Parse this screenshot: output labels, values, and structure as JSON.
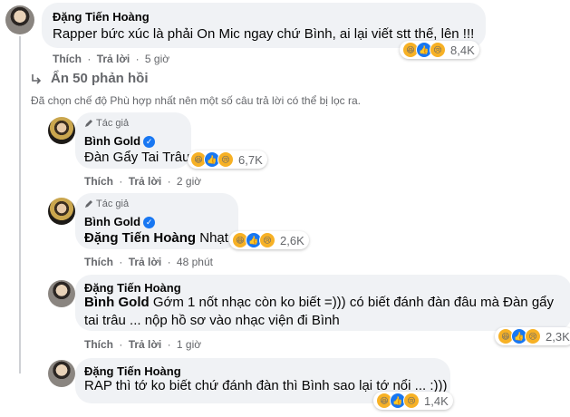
{
  "comments": [
    {
      "name": "Đặng Tiến Hoàng",
      "text": "Rapper bức xúc là phải On Mic ngay chứ Bình, ai lại viết stt thế, lên !!!",
      "like": "Thích",
      "reply": "Trả lời",
      "time": "5 giờ",
      "reactions": "8,4K"
    },
    {
      "author_tag": "Tác giả",
      "name": "Bình Gold",
      "text": "Đàn Gẩy Tai Trâu",
      "like": "Thích",
      "reply": "Trả lời",
      "time": "2 giờ",
      "reactions": "6,7K"
    },
    {
      "author_tag": "Tác giả",
      "name": "Bình Gold",
      "mention": "Đặng Tiến Hoàng",
      "text": " Nhạt",
      "like": "Thích",
      "reply": "Trả lời",
      "time": "48 phút",
      "reactions": "2,6K"
    },
    {
      "name": "Đặng Tiến Hoàng",
      "mention": "Bình Gold",
      "text_line1": " Gớm 1 nốt nhạc còn ko biết =))) có biết đánh đàn đâu mà Đàn gẩy",
      "text_line2": "tai trâu ... nộp hồ sơ vào nhạc viện đi Bình",
      "like": "Thích",
      "reply": "Trả lời",
      "time": "1 giờ",
      "reactions": "2,3K"
    },
    {
      "name": "Đặng Tiến Hoàng",
      "text": "RAP thì tớ ko biết chứ đánh đàn thì Bình sao lại tớ nổi ... :)))",
      "like": "Thích",
      "reply": "Trả lời",
      "time": "1 giờ",
      "reactions": "1,4K"
    }
  ],
  "hide_replies": "Ẩn 50 phản hồi",
  "filter_notice": "Đã chọn chế độ Phù hợp nhất nên một số câu trả lời có thể bị lọc ra.",
  "separator": "·",
  "icons": {
    "reply_arrow": "reply-arrow-icon",
    "pencil": "pencil-icon",
    "verified": "verified-badge-icon"
  }
}
